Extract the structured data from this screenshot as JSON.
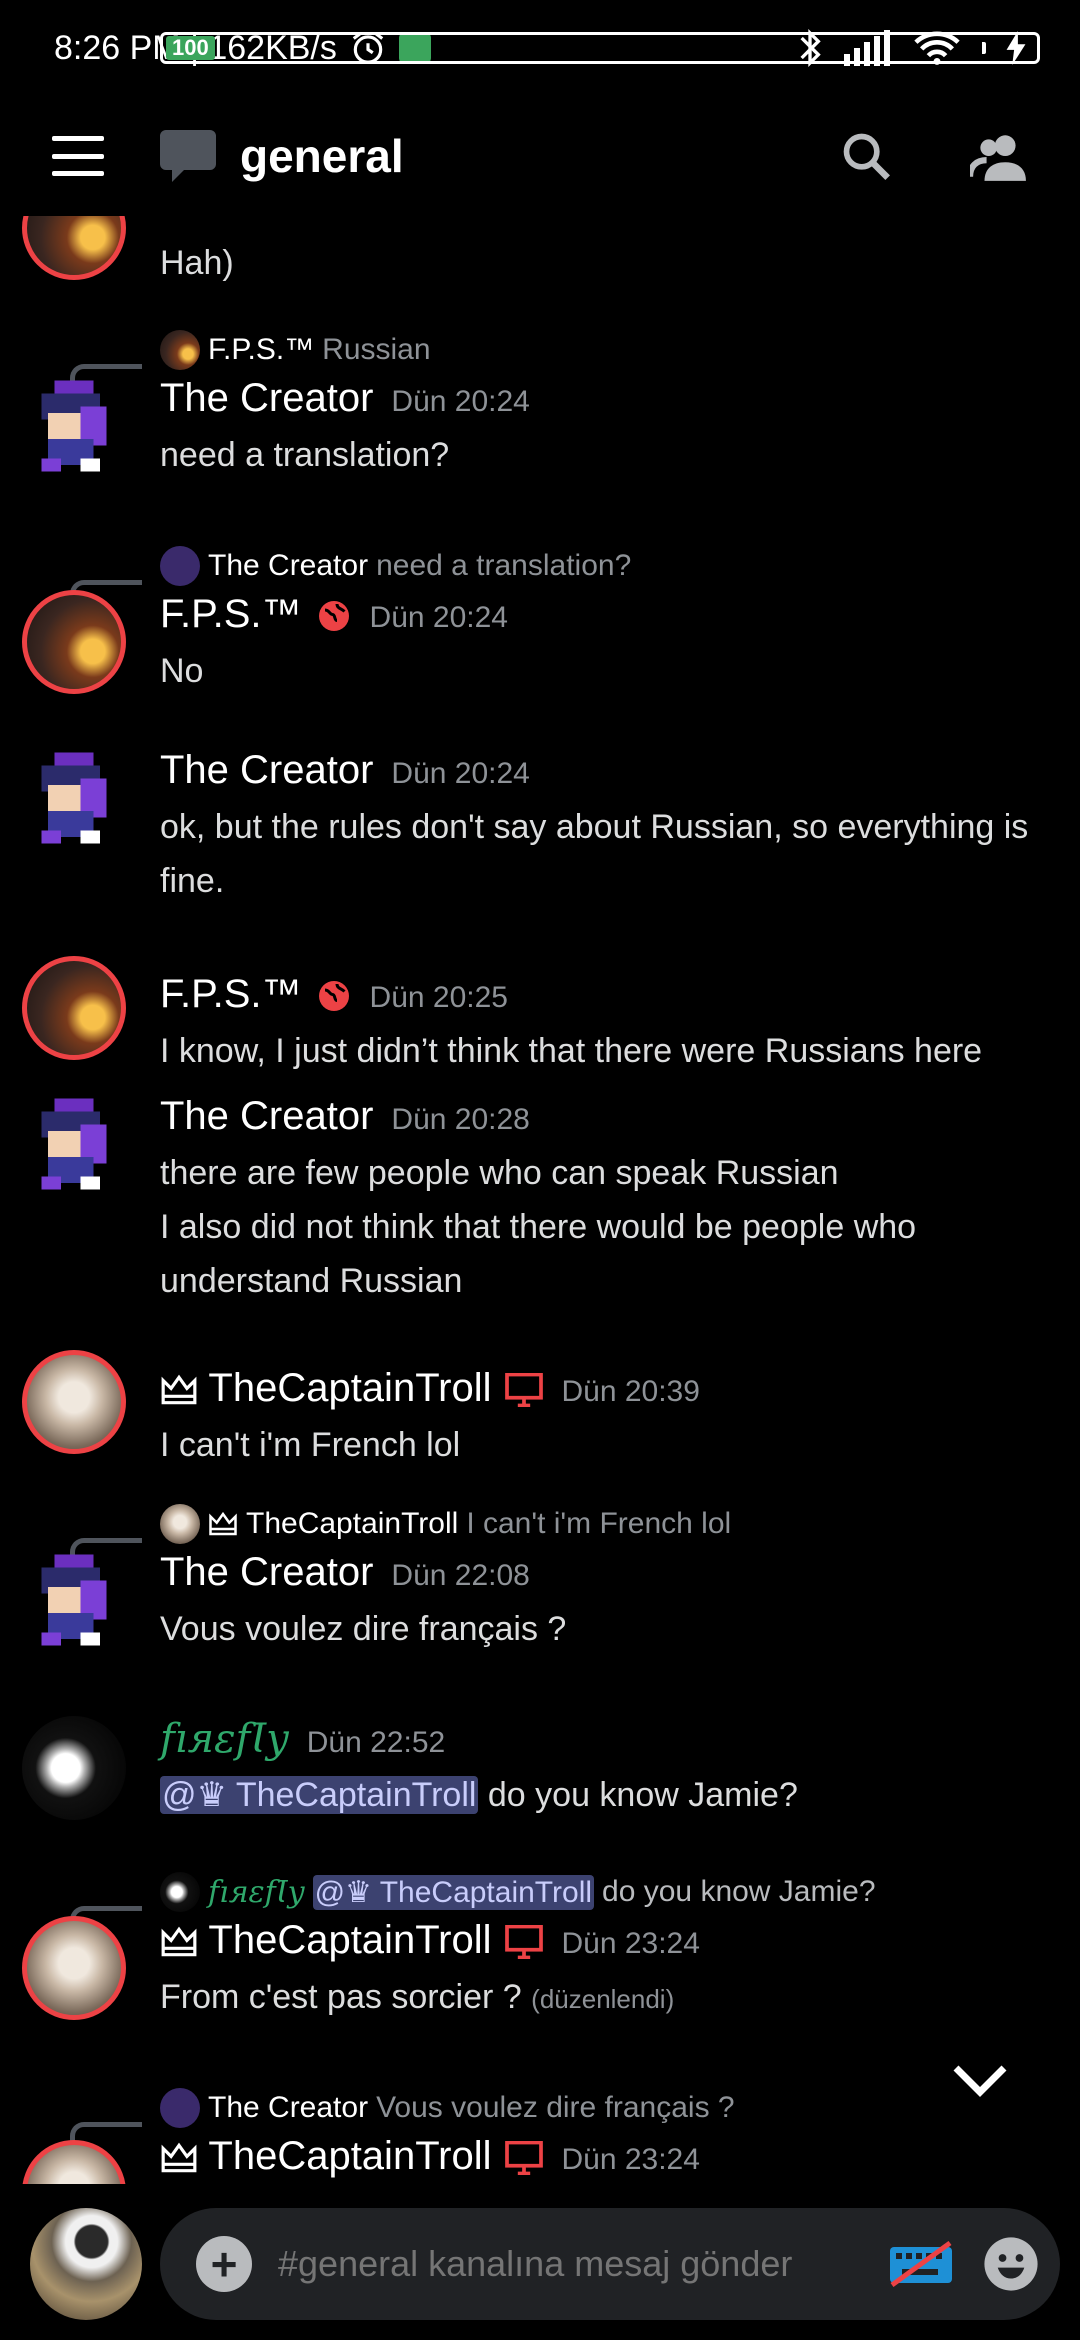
{
  "status_bar": {
    "time_speed": "8:26 PM | 162KB/s",
    "battery": "100"
  },
  "header": {
    "channel": "general"
  },
  "messages": {
    "m0": {
      "text": "Hah)"
    },
    "m1": {
      "reply_name": "F.P.S.™",
      "reply_text": "Russian",
      "author": "The Creator",
      "time": "Dün 20:24",
      "text": "need a translation?"
    },
    "m2": {
      "reply_name": "The Creator",
      "reply_text": "need a translation?",
      "author": "F.P.S.™",
      "time": "Dün 20:24",
      "text": "No"
    },
    "m3": {
      "author": "The Creator",
      "time": "Dün 20:24",
      "text": "ok, but the rules don't say about Russian, so everything is fine."
    },
    "m4": {
      "author": "F.P.S.™",
      "time": "Dün 20:25",
      "text": "I know, I just didn’t think that there were Russians here"
    },
    "m5": {
      "author": "The Creator",
      "time": "Dün 20:28",
      "line1": "there are few people who can speak Russian",
      "line2": "I also did not think that there would be people who understand Russian"
    },
    "m6": {
      "author": "TheCaptainTroll",
      "time": "Dün 20:39",
      "text": "I can't i'm French lol"
    },
    "m7": {
      "reply_name": "TheCaptainTroll",
      "reply_text": "I can't i'm French lol",
      "author": "The Creator",
      "time": "Dün 22:08",
      "text": "Vous voulez dire français ?"
    },
    "m8": {
      "author": "fıяɛfƖy",
      "time": "Dün 22:52",
      "mention": "@♛ TheCaptainTroll",
      "text": " do you know Jamie?"
    },
    "m9": {
      "reply_name": "fıяɛfƖy",
      "reply_mention": "@♛ TheCaptainTroll",
      "reply_text": " do you know Jamie?",
      "author": "TheCaptainTroll",
      "time": "Dün 23:24",
      "text": "From c'est pas sorcier ?",
      "edited": "(düzenlendi)"
    },
    "m10": {
      "reply_name": "The Creator",
      "reply_text": "Vous voulez dire français ?",
      "author": "TheCaptainTroll",
      "time": "Dün 23:24"
    }
  },
  "composer": {
    "placeholder": "#general kanalına mesaj gönder"
  },
  "icons": [
    "hamburger-icon",
    "channel-chat-icon",
    "search-icon",
    "members-icon",
    "globe-icon",
    "screen-share-icon",
    "crown-icon",
    "chevron-down-icon",
    "plus-icon",
    "keyboard-icon",
    "emoji-icon"
  ],
  "colors": {
    "background": "#000000",
    "accent_red": "#ed4245",
    "green_name": "#2fa86b",
    "muted_text": "#8e9297",
    "mention_bg": "#3c4270",
    "composer_bg": "#202225"
  }
}
